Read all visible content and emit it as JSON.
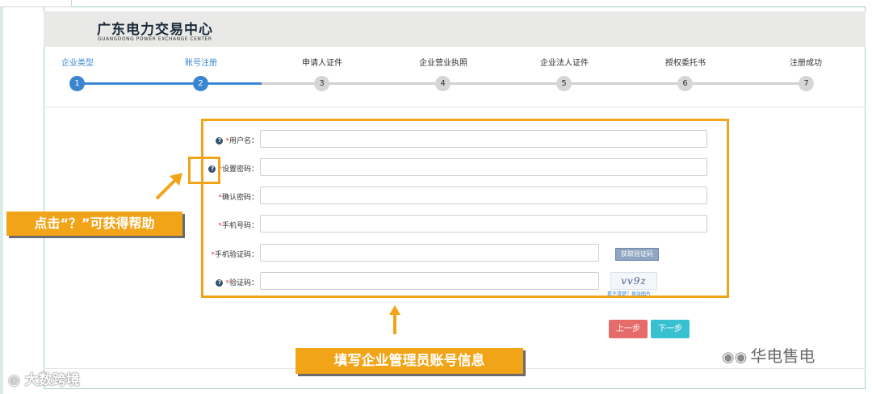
{
  "header": {
    "title_cn": "广东电力交易中心",
    "title_en": "GUANGDONG POWER EXCHANGE CENTER"
  },
  "steps": [
    {
      "label": "企业类型",
      "number": "1",
      "state": "active"
    },
    {
      "label": "账号注册",
      "number": "2",
      "state": "active"
    },
    {
      "label": "申请人证件",
      "number": "3",
      "state": "inactive"
    },
    {
      "label": "企业营业执照",
      "number": "4",
      "state": "inactive"
    },
    {
      "label": "企业法人证件",
      "number": "5",
      "state": "inactive"
    },
    {
      "label": "授权委托书",
      "number": "6",
      "state": "inactive"
    },
    {
      "label": "注册成功",
      "number": "7",
      "state": "inactive"
    }
  ],
  "form": {
    "help_glyph": "?",
    "required_mark": "*",
    "fields": {
      "username": {
        "label": "用户名：",
        "value": ""
      },
      "set_password": {
        "label": "设置密码：",
        "value": ""
      },
      "confirm_password": {
        "label": "确认密码：",
        "value": ""
      },
      "phone": {
        "label": "手机号码：",
        "value": ""
      },
      "sms_code": {
        "label": "手机验证码：",
        "value": ""
      },
      "captcha": {
        "label": "验证码：",
        "value": ""
      }
    },
    "get_sms_code_button": "获取验证码",
    "captcha_text": "vv9z",
    "captcha_refresh": "看不清楚？换张图片"
  },
  "buttons": {
    "prev": "上一步",
    "next": "下一步"
  },
  "annotations": {
    "help_tip": "点击“？”可获得帮助",
    "form_tip": "填写企业管理员账号信息"
  },
  "watermarks": {
    "right": "华电售电",
    "left": "大数跨境"
  },
  "colors": {
    "accent_blue": "#3a86d1",
    "highlight_orange": "#f2a418",
    "prev_red": "#e66b6b",
    "next_cyan": "#39c1d2"
  }
}
